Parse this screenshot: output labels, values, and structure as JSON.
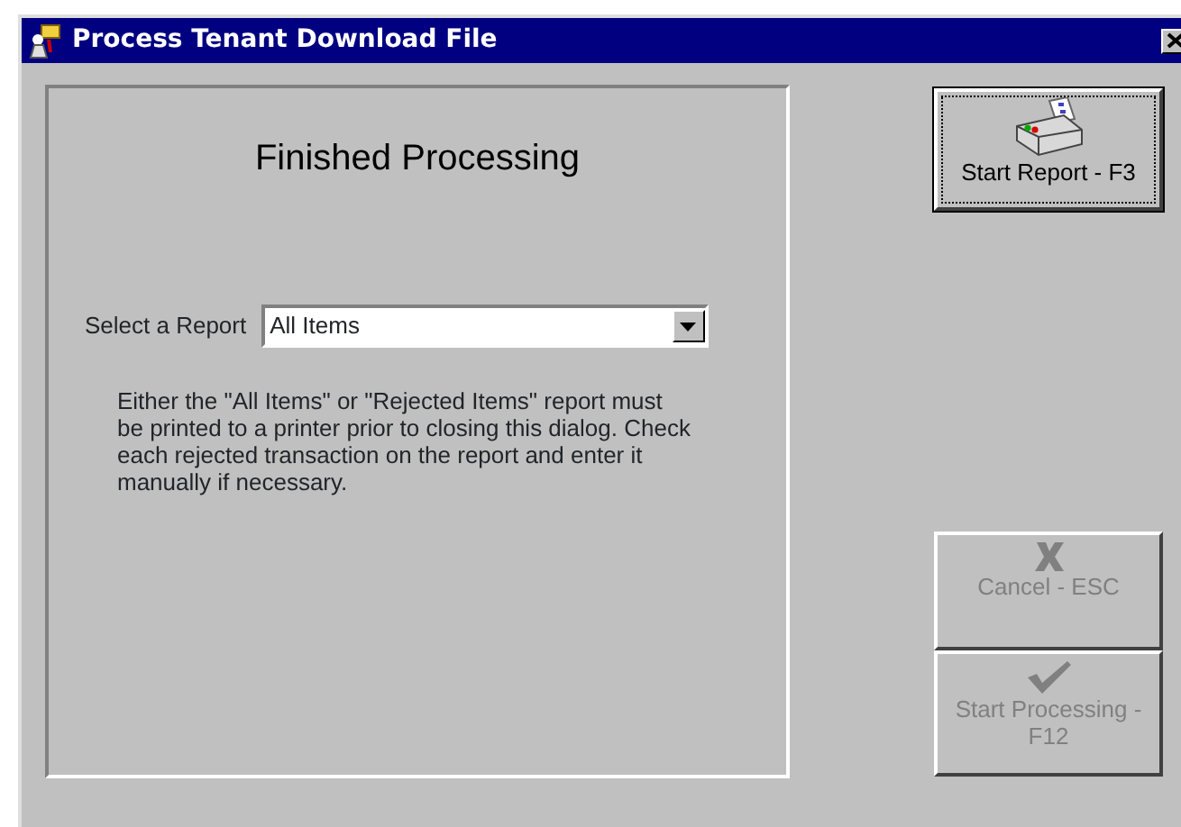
{
  "window": {
    "title": "Process Tenant Download File"
  },
  "panel": {
    "heading": "Finished Processing",
    "select": {
      "label": "Select a Report",
      "value": "All Items"
    },
    "message": "Either the \"All Items\" or \"Rejected Items\" report must be printed to a printer prior to closing this dialog. Check each rejected transaction on the report and enter it manually if necessary."
  },
  "buttons": [
    {
      "label": "Start Report - F3",
      "kind": "printer",
      "disabled": false,
      "focused": true
    },
    {
      "label": "Cancel - ESC",
      "kind": "cancel",
      "disabled": true,
      "focused": false
    },
    {
      "label": "Start Processing - F12",
      "kind": "check",
      "disabled": true,
      "focused": false
    }
  ]
}
